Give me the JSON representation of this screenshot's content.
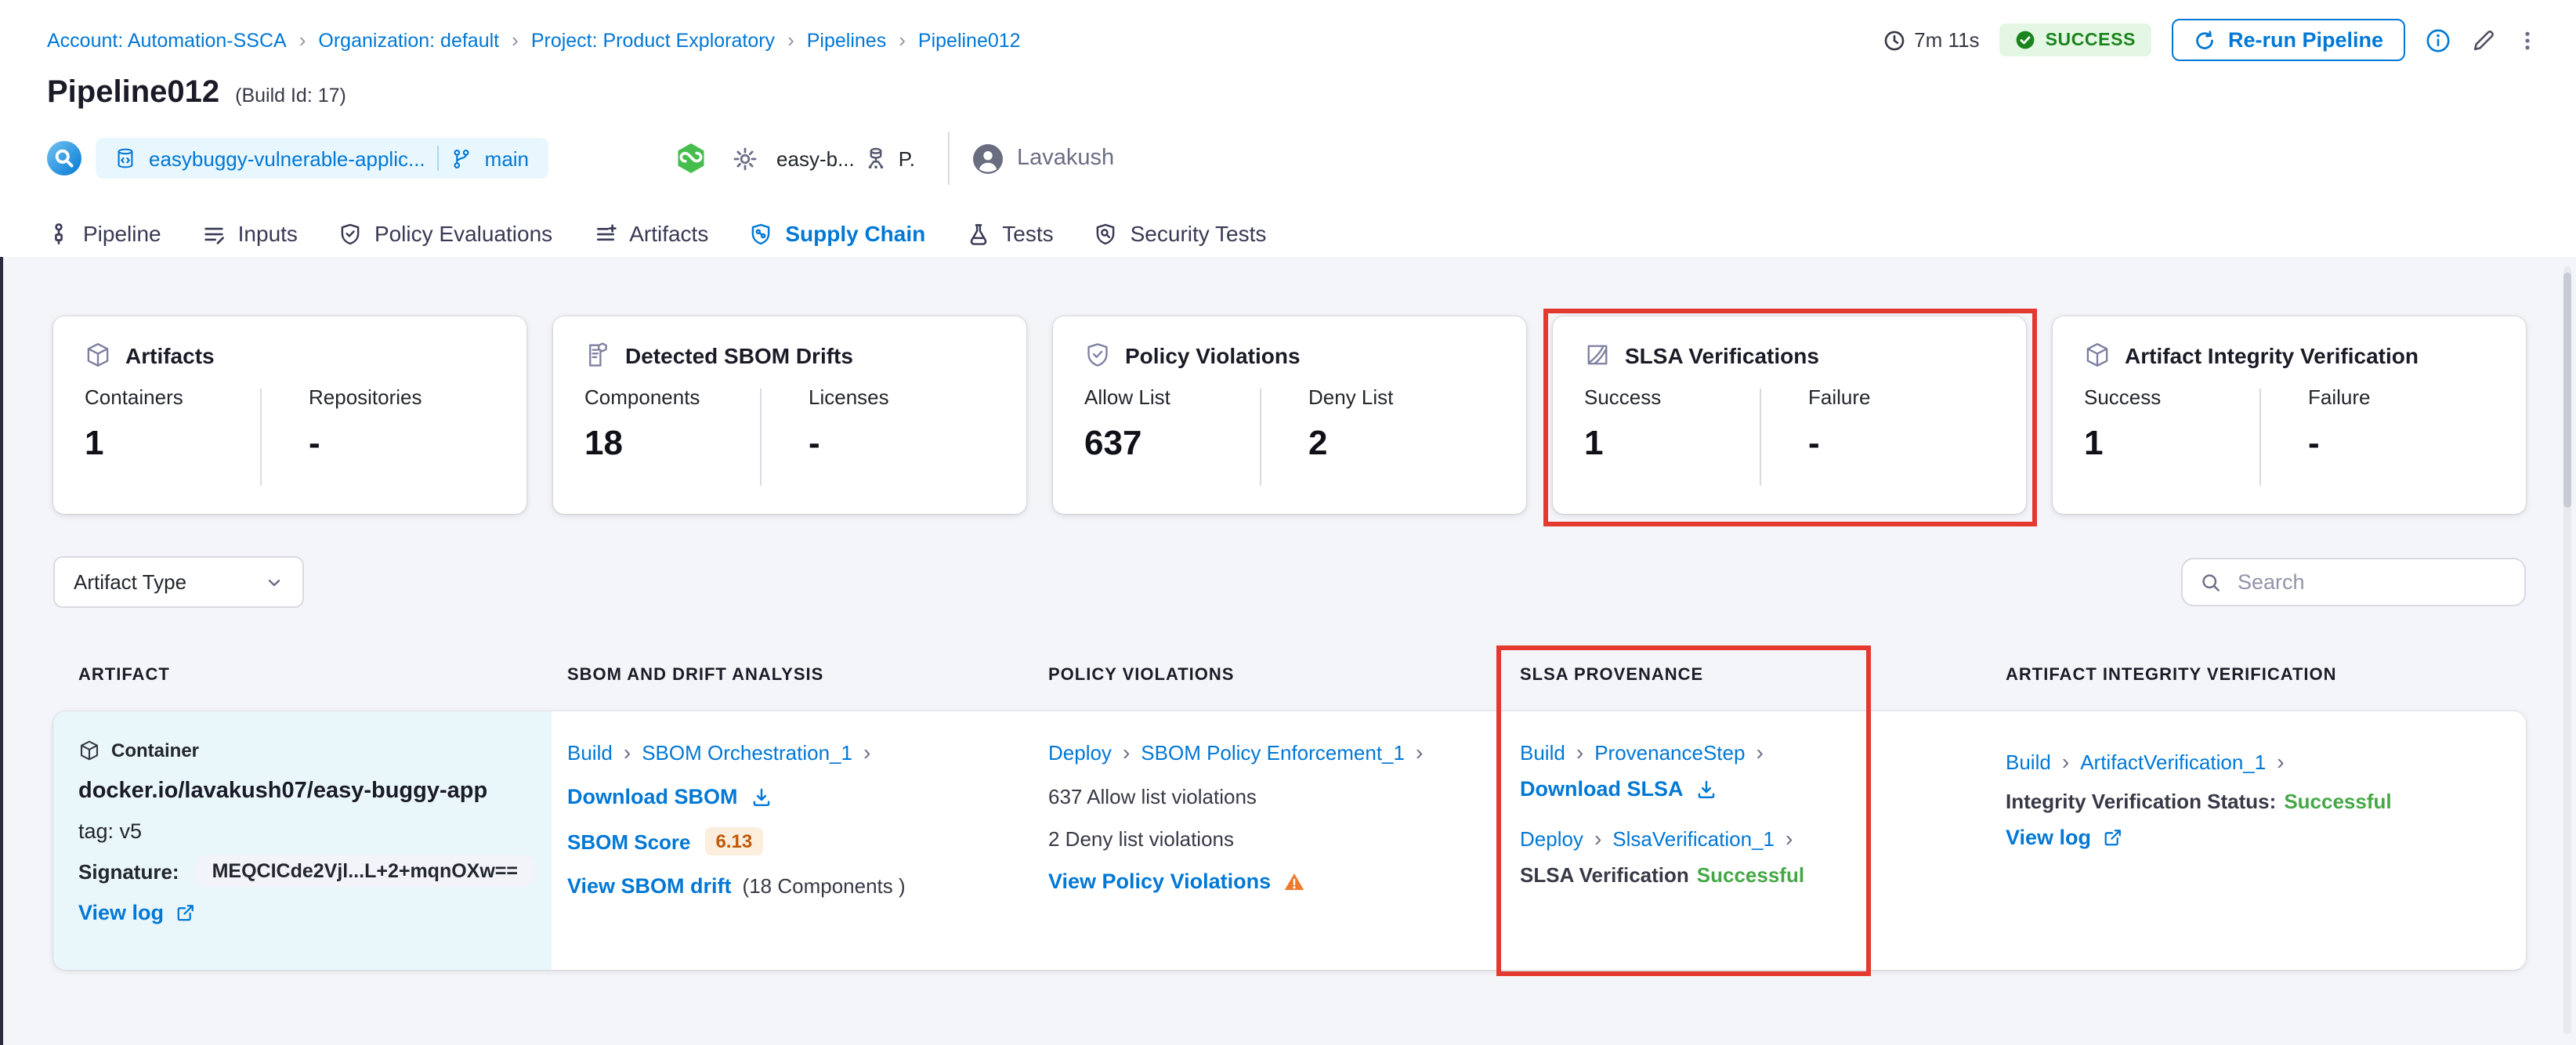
{
  "ui": {
    "chevron": "›",
    "accent": "#0278d5",
    "highlight_red": "#e4392e",
    "success_green": "#1b841d"
  },
  "breadcrumb": {
    "separator": "›",
    "items": [
      {
        "label": "Account: Automation-SSCA"
      },
      {
        "label": "Organization: default"
      },
      {
        "label": "Project: Product Exploratory"
      },
      {
        "label": "Pipelines"
      },
      {
        "label": "Pipeline012"
      }
    ]
  },
  "header": {
    "duration": "7m 11s",
    "status": "SUCCESS",
    "rerun_label": "Re-run Pipeline",
    "title": "Pipeline012",
    "build_id": "(Build Id: 17)",
    "repo": "easybuggy-vulnerable-applic...",
    "branch": "main",
    "trigger_project": "easy-b...",
    "trigger_short": "P.",
    "user": "Lavakush",
    "icons": [
      "clock-icon",
      "check-circle-icon",
      "refresh-icon",
      "info-icon",
      "edit-pencil-icon",
      "kebab-menu-icon",
      "trigger-icon",
      "repository-icon",
      "branch-icon",
      "webhook-icon",
      "gear-icon",
      "infrastructure-icon",
      "user-avatar-icon"
    ]
  },
  "tabs": [
    {
      "label": "Pipeline",
      "icon": "pipeline-icon"
    },
    {
      "label": "Inputs",
      "icon": "inputs-icon"
    },
    {
      "label": "Policy Evaluations",
      "icon": "policy-evaluations-icon"
    },
    {
      "label": "Artifacts",
      "icon": "artifacts-icon"
    },
    {
      "label": "Supply Chain",
      "icon": "supply-chain-icon",
      "active": true
    },
    {
      "label": "Tests",
      "icon": "tests-icon"
    },
    {
      "label": "Security Tests",
      "icon": "security-tests-icon"
    }
  ],
  "summary_cards": [
    {
      "title": "Artifacts",
      "icon": "cube-icon",
      "stats": [
        {
          "label": "Containers",
          "value": "1"
        },
        {
          "label": "Repositories",
          "value": "-"
        }
      ]
    },
    {
      "title": "Detected SBOM Drifts",
      "icon": "sbom-document-icon",
      "stats": [
        {
          "label": "Components",
          "value": "18"
        },
        {
          "label": "Licenses",
          "value": "-"
        }
      ]
    },
    {
      "title": "Policy Violations",
      "icon": "shield-check-icon",
      "stats": [
        {
          "label": "Allow List",
          "value": "637"
        },
        {
          "label": "Deny List",
          "value": "2"
        }
      ]
    },
    {
      "title": "SLSA Verifications",
      "icon": "slsa-shield-icon",
      "highlighted": true,
      "stats": [
        {
          "label": "Success",
          "value": "1"
        },
        {
          "label": "Failure",
          "value": "-"
        }
      ]
    },
    {
      "title": "Artifact Integrity Verification",
      "icon": "cube-icon",
      "stats": [
        {
          "label": "Success",
          "value": "1"
        },
        {
          "label": "Failure",
          "value": "-"
        }
      ]
    }
  ],
  "filters": {
    "artifact_type_label": "Artifact Type",
    "search_placeholder": "Search"
  },
  "table": {
    "headers": [
      "ARTIFACT",
      "SBOM AND DRIFT ANALYSIS",
      "POLICY VIOLATIONS",
      "SLSA PROVENANCE",
      "ARTIFACT INTEGRITY VERIFICATION"
    ],
    "row": {
      "artifact": {
        "type_label": "Container",
        "image": "docker.io/lavakush07/easy-buggy-app",
        "tag": "tag: v5",
        "signature_label": "Signature:",
        "signature_value": "MEQCICde2Vjl...L+2+mqnOXw==",
        "view_log": "View log"
      },
      "sbom": {
        "stage": "Build",
        "step": "SBOM Orchestration_1",
        "download": "Download SBOM",
        "score_label": "SBOM Score",
        "score": "6.13",
        "drift_link": "View SBOM drift",
        "drift_suffix": "(18 Components )"
      },
      "policy": {
        "stage": "Deploy",
        "step": "SBOM Policy Enforcement_1",
        "allow": "637 Allow list violations",
        "deny": "2 Deny list violations",
        "view": "View Policy Violations"
      },
      "slsa": {
        "stage1": "Build",
        "step1": "ProvenanceStep",
        "download": "Download SLSA",
        "stage2": "Deploy",
        "step2": "SlsaVerification_1",
        "status_label": "SLSA Verification",
        "status_value": "Successful"
      },
      "integrity": {
        "stage": "Build",
        "step": "ArtifactVerification_1",
        "status_label": "Integrity Verification Status:",
        "status_value": "Successful",
        "view_log": "View log"
      }
    }
  }
}
